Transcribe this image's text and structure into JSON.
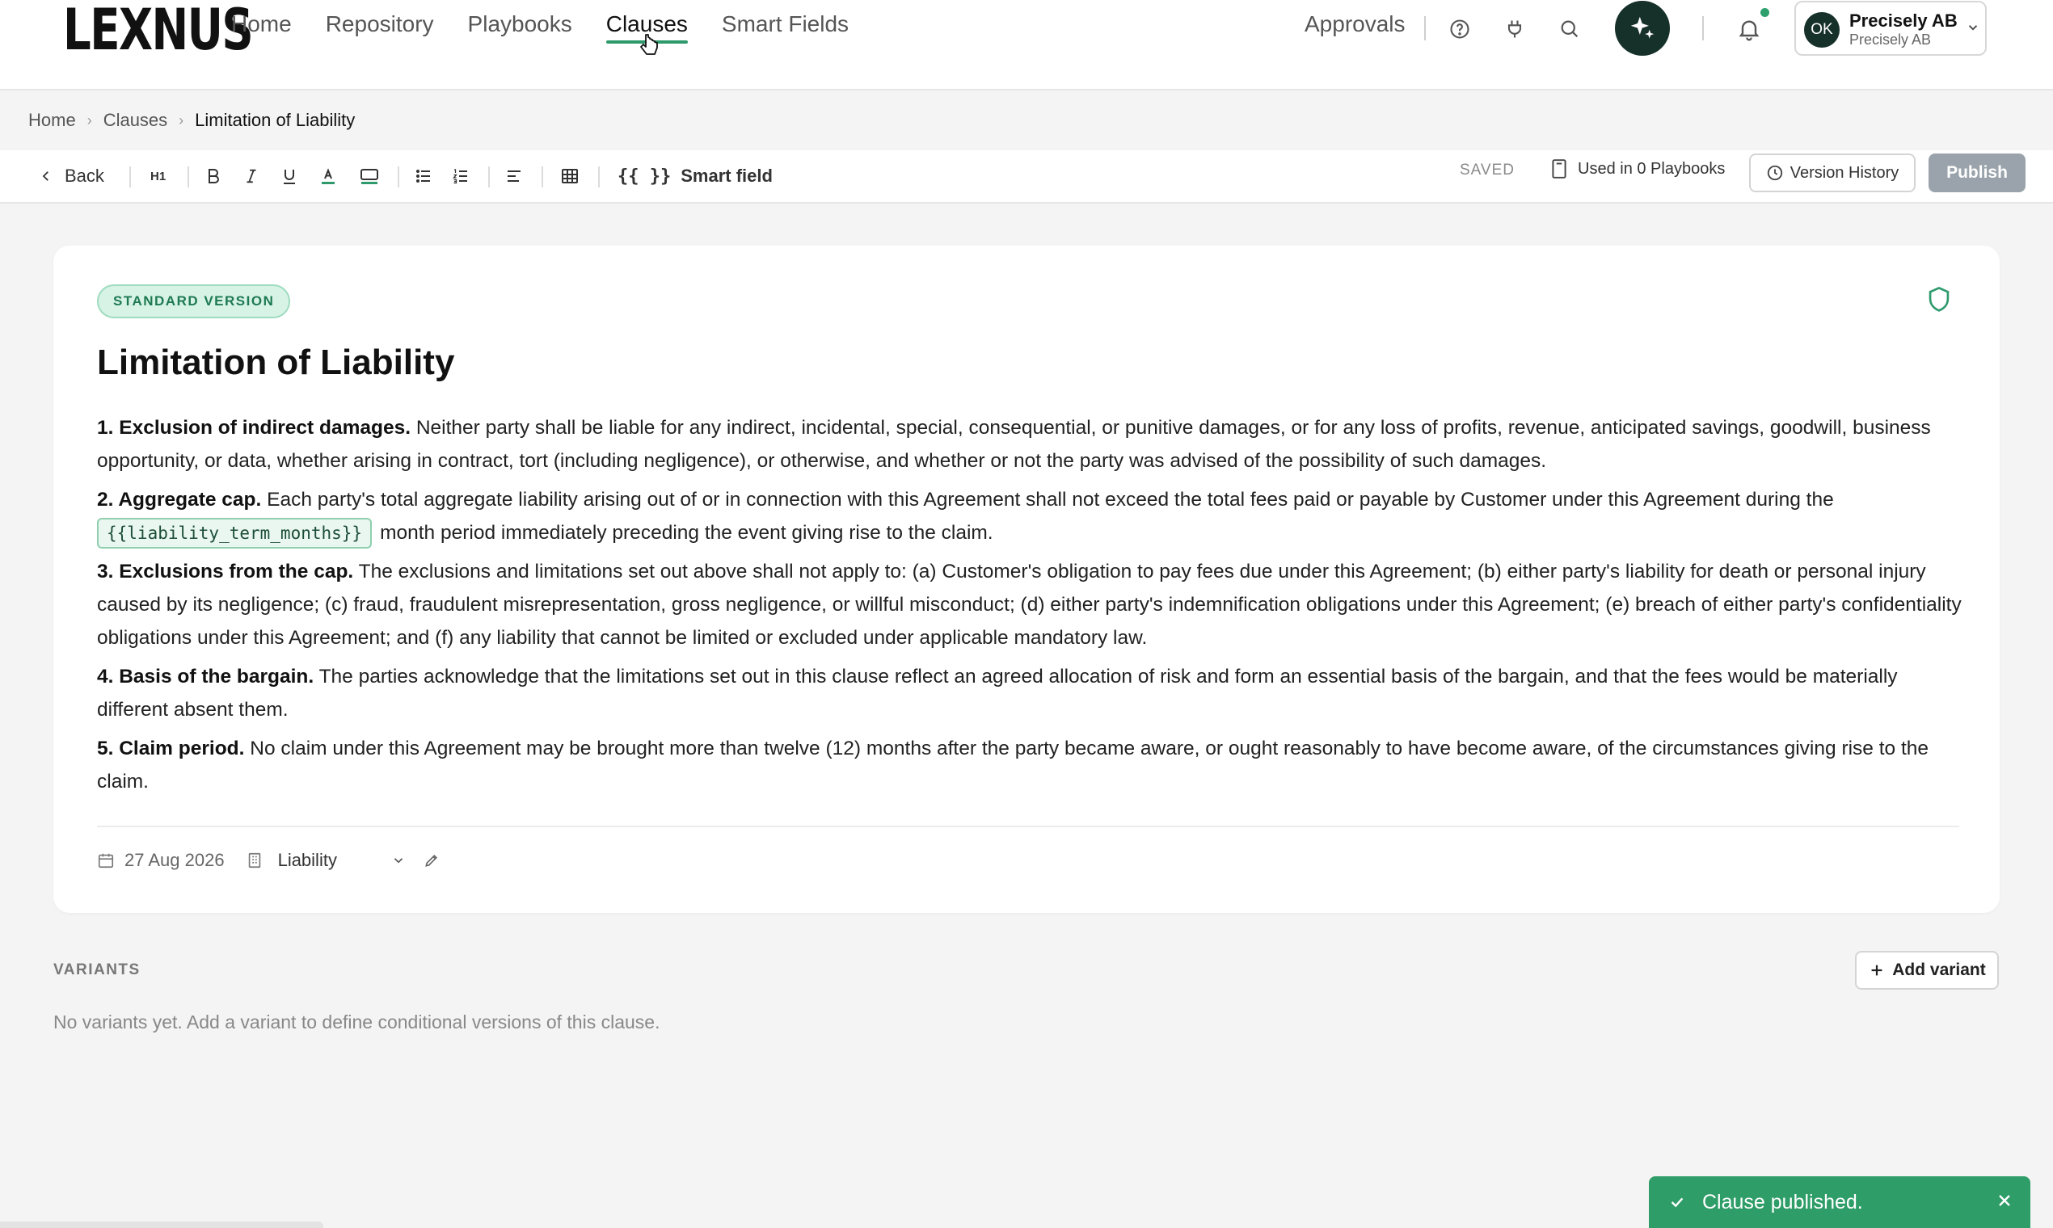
{
  "app": {
    "logo": "LEXNUS"
  },
  "nav": {
    "items": [
      "Home",
      "Repository",
      "Playbooks",
      "Clauses",
      "Smart Fields"
    ],
    "active": "Clauses",
    "approvals": "Approvals"
  },
  "account": {
    "initials": "OK",
    "name": "Precisely AB",
    "org": "Precisely AB"
  },
  "breadcrumb": [
    "Home",
    "Clauses",
    "Limitation of Liability"
  ],
  "toolbar": {
    "back": "Back",
    "h1": "H1",
    "smart_field_braces": "{{ }}",
    "smart_field_label": "Smart field",
    "status": "SAVED",
    "used_in": "Used in 0 Playbooks",
    "version_history": "Version History",
    "publish": "Publish"
  },
  "clause": {
    "badge": "STANDARD VERSION",
    "title": "Limitation of Liability",
    "sections": [
      {
        "heading": "1. Exclusion of indirect damages.",
        "text": "Neither party shall be liable for any indirect, incidental, special, consequential, or punitive damages, or for any loss of profits, revenue, anticipated savings, goodwill, business opportunity, or data, whether arising in contract, tort (including negligence), or otherwise, and whether or not the party was advised of the possibility of such damages."
      },
      {
        "heading": "2. Aggregate cap.",
        "text": "Each party's total aggregate liability arising out of or in connection with this Agreement shall not exceed the total fees paid or payable by Customer under this Agreement during the",
        "field": "{{liability_term_months}}",
        "text_after": "month period immediately preceding the event giving rise to the claim."
      },
      {
        "heading": "3. Exclusions from the cap.",
        "text": "The exclusions and limitations set out above shall not apply to: (a) Customer's obligation to pay fees due under this Agreement; (b) either party's liability for death or personal injury caused by its negligence; (c) fraud, fraudulent misrepresentation, gross negligence, or willful misconduct; (d) either party's indemnification obligations under this Agreement; (e) breach of either party's confidentiality obligations under this Agreement; and (f) any liability that cannot be limited or excluded under applicable mandatory law."
      },
      {
        "heading": "4. Basis of the bargain.",
        "text": "The parties acknowledge that the limitations set out in this clause reflect an agreed allocation of risk and form an essential basis of the bargain, and that the fees would be materially different absent them."
      },
      {
        "heading": "5. Claim period.",
        "text": "No claim under this Agreement may be brought more than twelve (12) months after the party became aware, or ought reasonably to have become aware, of the circumstances giving rise to the claim."
      }
    ],
    "date": "27 Aug 2026",
    "category": "Liability"
  },
  "variants": {
    "heading": "VARIANTS",
    "add_label": "Add variant",
    "empty_text": "No variants yet. Add a variant to define conditional versions of this clause."
  },
  "toast": {
    "message": "Clause published."
  },
  "colors": {
    "accent": "#2e9a6c",
    "dark": "#16302a",
    "publish_disabled": "#9aa3ab",
    "toast": "#2f9d68"
  }
}
